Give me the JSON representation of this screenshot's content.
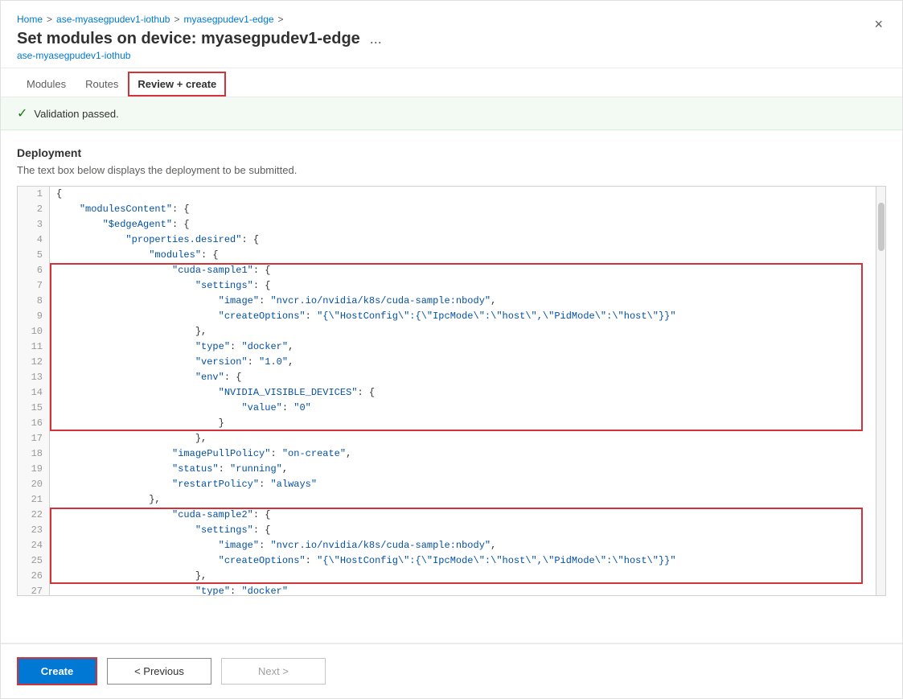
{
  "window": {
    "title": "Set modules on device: myasegpudev1-edge",
    "subtitle": "ase-myasegpudev1-iothub",
    "ellipsis_label": "...",
    "close_label": "×"
  },
  "breadcrumb": {
    "items": [
      "Home",
      "ase-myasegpudev1-iothub",
      "myasegpudev1-edge"
    ],
    "separators": [
      ">",
      ">",
      ">"
    ]
  },
  "tabs": {
    "items": [
      {
        "label": "Modules",
        "active": false
      },
      {
        "label": "Routes",
        "active": false
      },
      {
        "label": "Review + create",
        "active": true
      }
    ]
  },
  "validation": {
    "icon": "✓",
    "text": "Validation passed."
  },
  "deployment": {
    "section_title": "Deployment",
    "description": "The text box below displays the deployment to be submitted."
  },
  "code": {
    "lines": [
      {
        "num": 1,
        "text": "{"
      },
      {
        "num": 2,
        "text": "    \"modulesContent\": {"
      },
      {
        "num": 3,
        "text": "        \"$edgeAgent\": {"
      },
      {
        "num": 4,
        "text": "            \"properties.desired\": {"
      },
      {
        "num": 5,
        "text": "                \"modules\": {"
      },
      {
        "num": 6,
        "text": "                    \"cuda-sample1\": {"
      },
      {
        "num": 7,
        "text": "                        \"settings\": {"
      },
      {
        "num": 8,
        "text": "                            \"image\": \"nvcr.io/nvidia/k8s/cuda-sample:nbody\","
      },
      {
        "num": 9,
        "text": "                            \"createOptions\": \"{\\\"HostConfig\\\":{\\\"IpcMode\\\":\\\"host\\\",\\\"PidMode\\\":\\\"host\\\"}}\""
      },
      {
        "num": 10,
        "text": "                        },"
      },
      {
        "num": 11,
        "text": "                        \"type\": \"docker\","
      },
      {
        "num": 12,
        "text": "                        \"version\": \"1.0\","
      },
      {
        "num": 13,
        "text": "                        \"env\": {"
      },
      {
        "num": 14,
        "text": "                            \"NVIDIA_VISIBLE_DEVICES\": {"
      },
      {
        "num": 15,
        "text": "                                \"value\": \"0\""
      },
      {
        "num": 16,
        "text": "                            }"
      },
      {
        "num": 17,
        "text": "                        },"
      },
      {
        "num": 18,
        "text": "                    \"imagePullPolicy\": \"on-create\","
      },
      {
        "num": 19,
        "text": "                    \"status\": \"running\","
      },
      {
        "num": 20,
        "text": "                    \"restartPolicy\": \"always\""
      },
      {
        "num": 21,
        "text": "                },"
      },
      {
        "num": 22,
        "text": "                    \"cuda-sample2\": {"
      },
      {
        "num": 23,
        "text": "                        \"settings\": {"
      },
      {
        "num": 24,
        "text": "                            \"image\": \"nvcr.io/nvidia/k8s/cuda-sample:nbody\","
      },
      {
        "num": 25,
        "text": "                            \"createOptions\": \"{\\\"HostConfig\\\":{\\\"IpcMode\\\":\\\"host\\\",\\\"PidMode\\\":\\\"host\\\"}}\""
      },
      {
        "num": 26,
        "text": "                        },"
      },
      {
        "num": 27,
        "text": "                        \"type\": \"docker\""
      }
    ]
  },
  "footer": {
    "create_label": "Create",
    "prev_label": "< Previous",
    "next_label": "Next >"
  }
}
